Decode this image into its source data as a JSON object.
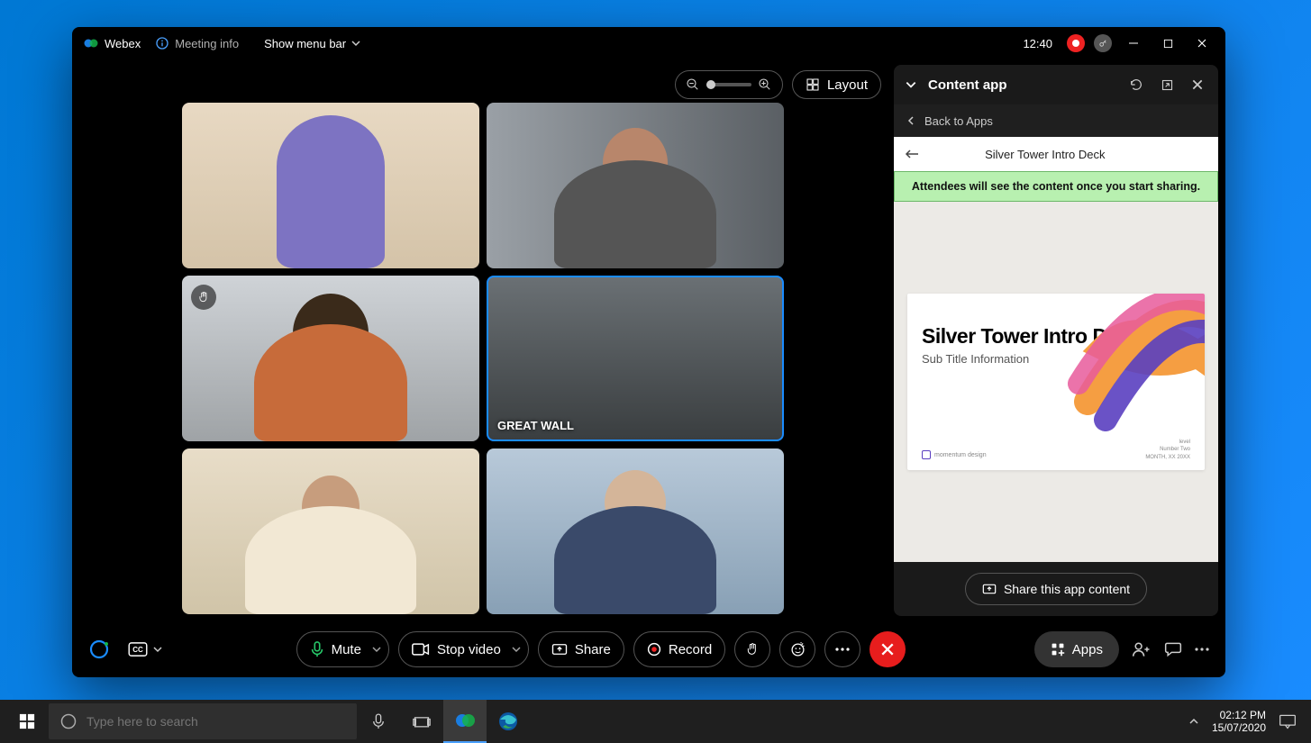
{
  "title_bar": {
    "app_name": "Webex",
    "meeting_info": "Meeting info",
    "show_menu": "Show menu bar",
    "clock": "12:40"
  },
  "video_top": {
    "layout": "Layout"
  },
  "tiles": {
    "great_wall": "GREAT WALL"
  },
  "side_panel": {
    "title": "Content app",
    "back_to_apps": "Back to Apps",
    "deck_title": "Silver Tower Intro Deck",
    "notice": "Attendees will see the content once you start sharing.",
    "slide_title": "Silver Tower Intro Deck",
    "slide_subtitle": "Sub Title Information",
    "slide_footer_brand": "momentum design",
    "slide_footer_right1": "level",
    "slide_footer_right2": "Number Two",
    "slide_footer_date": "MONTH, XX 20XX",
    "share_btn": "Share this app content"
  },
  "controls": {
    "mute": "Mute",
    "stop_video": "Stop video",
    "share": "Share",
    "record": "Record",
    "apps": "Apps"
  },
  "taskbar": {
    "search_placeholder": "Type here to search",
    "time": "02:12 PM",
    "date": "15/07/2020"
  }
}
